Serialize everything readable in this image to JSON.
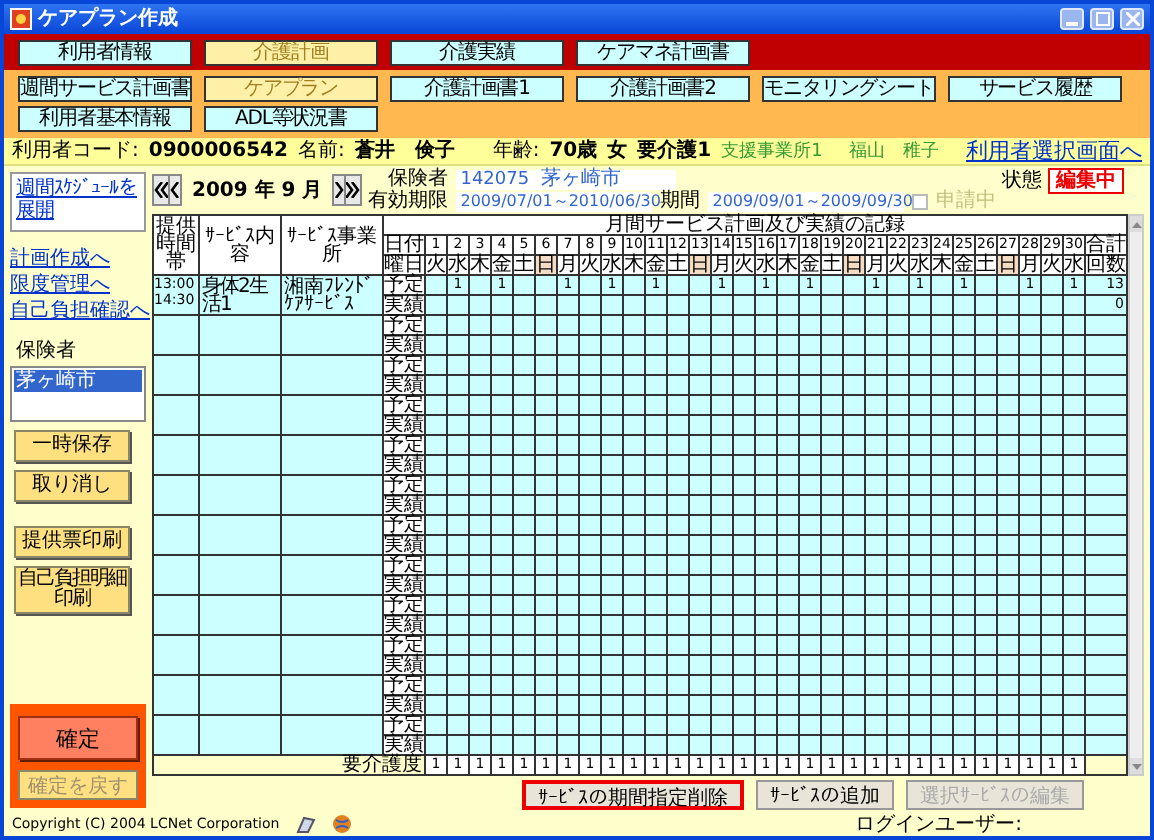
{
  "window": {
    "title": "ケアプラン作成"
  },
  "main_tabs": [
    {
      "label": "利用者情報",
      "selected": false
    },
    {
      "label": "介護計画",
      "selected": true
    },
    {
      "label": "介護実績",
      "selected": false
    },
    {
      "label": "ケアマネ計画書",
      "selected": false
    }
  ],
  "sub_tabs": [
    {
      "label": "週間サービス計画書",
      "selected": false
    },
    {
      "label": "ケアプラン",
      "selected": true
    },
    {
      "label": "介護計画書1",
      "selected": false
    },
    {
      "label": "介護計画書2",
      "selected": false
    },
    {
      "label": "モニタリングシート",
      "selected": false
    },
    {
      "label": "サービス履歴",
      "selected": false
    },
    {
      "label": "利用者基本情報",
      "selected": false
    },
    {
      "label": "ADL等状況書",
      "selected": false
    }
  ],
  "user_bar": {
    "code_label": "利用者コード:",
    "code": "0900006542",
    "name_label": "名前:",
    "name": "蒼井　倹子",
    "age_label": "年齢:",
    "age": "70歳",
    "sex": "女",
    "care_level": "要介護1",
    "office": "支援事業所1",
    "manager": "福山　稚子",
    "link": "利用者選択画面へ"
  },
  "sidebar": {
    "schedule_link": "週間ｽｹｼﾞｭｰﾙを展開",
    "links": [
      "計画作成へ",
      "限度管理へ",
      "自己負担確認へ"
    ],
    "insurer_label": "保険者",
    "insurers": [
      {
        "label": "茅ヶ崎市",
        "selected": true
      }
    ],
    "buttons": [
      {
        "label": "一時保存",
        "kind": "large"
      },
      {
        "label": "取り消し",
        "kind": "large"
      },
      {
        "label": "提供票印刷",
        "kind": "large"
      },
      {
        "label": "自己負担明細印刷",
        "kind": "small"
      }
    ],
    "confirm": {
      "label": "確定"
    },
    "undo": {
      "label": "確定を戻す",
      "disabled": true
    }
  },
  "period": {
    "month": "2009 年 9 月",
    "insurer_label": "保険者",
    "insurer_code": "142075",
    "insurer_name": "茅ヶ崎市",
    "valid_label": "有効期限",
    "valid": "2009/07/01～2010/06/30",
    "period_label": "期間",
    "period": "2009/09/01～2009/09/30",
    "applying": {
      "label": "申請中",
      "checked": false,
      "disabled": true
    },
    "status_label": "状態",
    "status": "編集中"
  },
  "table": {
    "title": "月間サービス計画及び実績の記録",
    "columns": [
      "提供時間帯",
      "ｻｰﾋﾞｽ内容",
      "ｻｰﾋﾞｽ事業所"
    ],
    "date_label": "日付",
    "weekday_label": "曜日",
    "total_label": "合計",
    "count_label": "回数",
    "days": [
      {
        "day": "1",
        "weekday": "火",
        "holiday": false
      },
      {
        "day": "2",
        "weekday": "水",
        "holiday": false
      },
      {
        "day": "3",
        "weekday": "木",
        "holiday": false
      },
      {
        "day": "4",
        "weekday": "金",
        "holiday": false
      },
      {
        "day": "5",
        "weekday": "土",
        "holiday": false
      },
      {
        "day": "6",
        "weekday": "日",
        "holiday": true
      },
      {
        "day": "7",
        "weekday": "月",
        "holiday": false
      },
      {
        "day": "8",
        "weekday": "火",
        "holiday": false
      },
      {
        "day": "9",
        "weekday": "水",
        "holiday": false
      },
      {
        "day": "10",
        "weekday": "木",
        "holiday": false
      },
      {
        "day": "11",
        "weekday": "金",
        "holiday": false
      },
      {
        "day": "12",
        "weekday": "土",
        "holiday": false
      },
      {
        "day": "13",
        "weekday": "日",
        "holiday": true
      },
      {
        "day": "14",
        "weekday": "月",
        "holiday": false
      },
      {
        "day": "15",
        "weekday": "火",
        "holiday": false
      },
      {
        "day": "16",
        "weekday": "水",
        "holiday": false
      },
      {
        "day": "17",
        "weekday": "木",
        "holiday": false
      },
      {
        "day": "18",
        "weekday": "金",
        "holiday": false
      },
      {
        "day": "19",
        "weekday": "土",
        "holiday": false
      },
      {
        "day": "20",
        "weekday": "日",
        "holiday": true
      },
      {
        "day": "21",
        "weekday": "月",
        "holiday": false
      },
      {
        "day": "22",
        "weekday": "火",
        "holiday": false
      },
      {
        "day": "23",
        "weekday": "水",
        "holiday": false
      },
      {
        "day": "24",
        "weekday": "木",
        "holiday": false
      },
      {
        "day": "25",
        "weekday": "金",
        "holiday": false
      },
      {
        "day": "26",
        "weekday": "土",
        "holiday": false
      },
      {
        "day": "27",
        "weekday": "日",
        "holiday": true
      },
      {
        "day": "28",
        "weekday": "月",
        "holiday": false
      },
      {
        "day": "29",
        "weekday": "火",
        "holiday": false
      },
      {
        "day": "30",
        "weekday": "水",
        "holiday": false
      }
    ],
    "rows": [
      {
        "kind": "service",
        "time_start": "13:00",
        "time_end": "14:30",
        "content": "身体2生活1",
        "office": "湘南ﾌﾚﾝﾄﾞｹｱｻｰﾋﾞｽ",
        "plan_label": "予定",
        "actual_label": "実績",
        "plan": [
          {
            "kind": "blank"
          },
          {
            "kind": "mark",
            "value": "1"
          },
          {
            "kind": "blank"
          },
          {
            "kind": "mark",
            "value": "1"
          },
          {
            "kind": "blank"
          },
          {
            "kind": "blank"
          },
          {
            "kind": "mark",
            "value": "1"
          },
          {
            "kind": "blank"
          },
          {
            "kind": "mark",
            "value": "1"
          },
          {
            "kind": "blank"
          },
          {
            "kind": "mark",
            "value": "1"
          },
          {
            "kind": "blank"
          },
          {
            "kind": "blank"
          },
          {
            "kind": "mark",
            "value": "1"
          },
          {
            "kind": "blank"
          },
          {
            "kind": "mark",
            "value": "1"
          },
          {
            "kind": "blank"
          },
          {
            "kind": "mark",
            "value": "1"
          },
          {
            "kind": "blank"
          },
          {
            "kind": "blank"
          },
          {
            "kind": "mark",
            "value": "1"
          },
          {
            "kind": "blank"
          },
          {
            "kind": "mark",
            "value": "1"
          },
          {
            "kind": "blank"
          },
          {
            "kind": "mark",
            "value": "1"
          },
          {
            "kind": "blank"
          },
          {
            "kind": "blank"
          },
          {
            "kind": "mark",
            "value": "1"
          },
          {
            "kind": "blank"
          },
          {
            "kind": "mark",
            "value": "1"
          }
        ],
        "plan_total": "13",
        "actual_total": "0"
      },
      {
        "kind": "empty",
        "plan_label": "予定",
        "actual_label": "実績"
      },
      {
        "kind": "empty",
        "plan_label": "予定",
        "actual_label": "実績"
      },
      {
        "kind": "empty",
        "plan_label": "予定",
        "actual_label": "実績"
      },
      {
        "kind": "empty",
        "plan_label": "予定",
        "actual_label": "実績"
      },
      {
        "kind": "empty",
        "plan_label": "予定",
        "actual_label": "実績"
      },
      {
        "kind": "empty",
        "plan_label": "予定",
        "actual_label": "実績"
      },
      {
        "kind": "empty",
        "plan_label": "予定",
        "actual_label": "実績"
      },
      {
        "kind": "empty",
        "plan_label": "予定",
        "actual_label": "実績"
      },
      {
        "kind": "empty",
        "plan_label": "予定",
        "actual_label": "実績"
      },
      {
        "kind": "empty",
        "plan_label": "予定",
        "actual_label": "実績"
      },
      {
        "kind": "empty",
        "plan_label": "予定",
        "actual_label": "実績"
      }
    ],
    "care_level_label": "要介護度",
    "care_levels": [
      "1",
      "1",
      "1",
      "1",
      "1",
      "1",
      "1",
      "1",
      "1",
      "1",
      "1",
      "1",
      "1",
      "1",
      "1",
      "1",
      "1",
      "1",
      "1",
      "1",
      "1",
      "1",
      "1",
      "1",
      "1",
      "1",
      "1",
      "1",
      "1",
      "1"
    ]
  },
  "actions": [
    {
      "label": "ｻｰﾋﾞｽの期間指定削除",
      "focused": true,
      "disabled": false
    },
    {
      "label": "ｻｰﾋﾞｽの追加",
      "focused": false,
      "disabled": false
    },
    {
      "label": "選択ｻｰﾋﾞｽの編集",
      "focused": false,
      "disabled": true
    }
  ],
  "footer": {
    "copyright": "Copyright (C) 2004 LCNet Corporation",
    "login_label": "ログインユーザー:"
  }
}
